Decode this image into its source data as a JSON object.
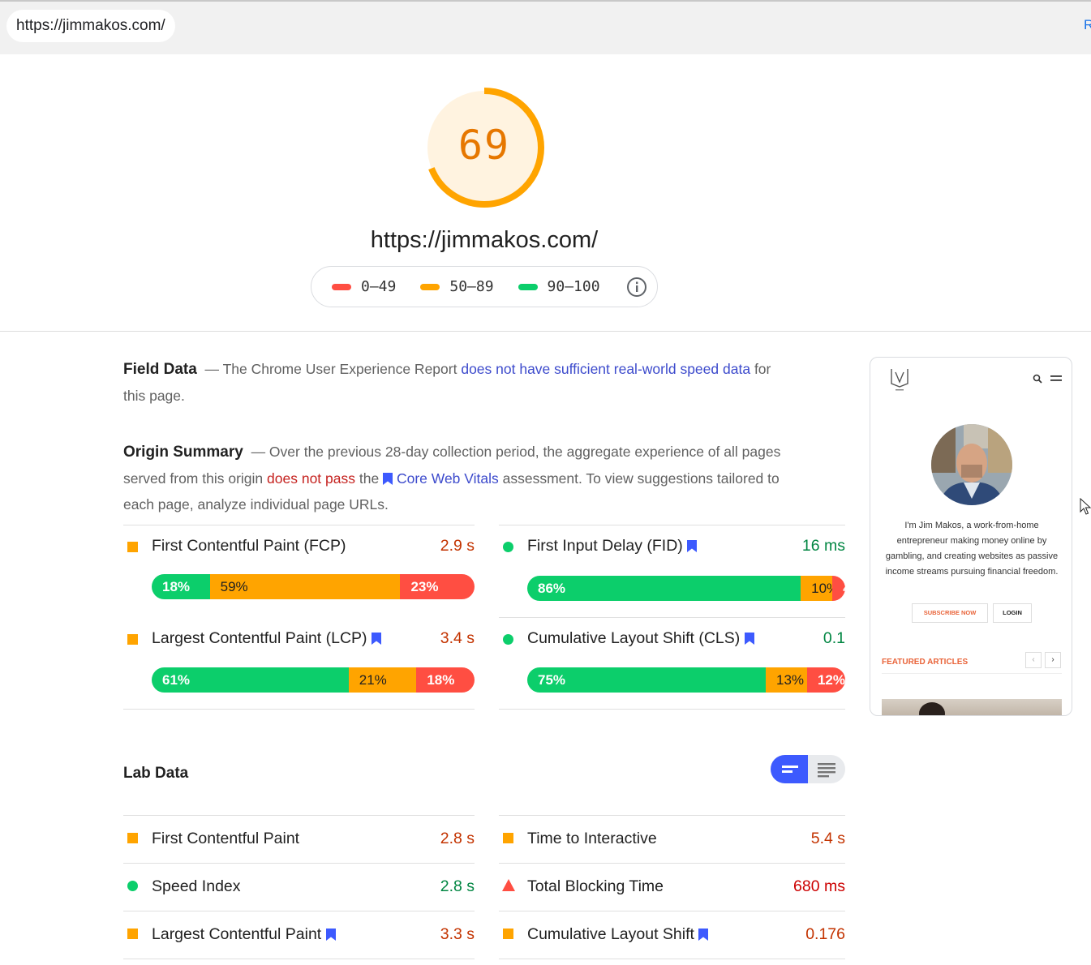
{
  "browser": {
    "url": "https://jimmakos.com/",
    "top_right": "R"
  },
  "report": {
    "score": "69",
    "url": "https://jimmakos.com/",
    "legend": [
      {
        "label": "0–49",
        "color": "#ff4e42"
      },
      {
        "label": "50–89",
        "color": "#ffa400"
      },
      {
        "label": "90–100",
        "color": "#0cce6b"
      }
    ]
  },
  "field_data": {
    "title": "Field Data",
    "dash": "— The Chrome User Experience Report",
    "link": "does not have sufficient real-world speed data",
    "tail": "for this page."
  },
  "origin_summary": {
    "title": "Origin Summary",
    "dash": "— Over the previous 28-day collection period, the aggregate experience of all pages served from this origin",
    "fail": "does not pass",
    "the": "the",
    "cwv": "Core Web Vitals",
    "tail": "assessment. To view suggestions tailored to each page, analyze individual page URLs."
  },
  "field_metrics": [
    {
      "name": "First Contentful Paint (FCP)",
      "value": "2.9 s",
      "rating": "average",
      "dist": [
        "18%",
        "59%",
        "23%"
      ],
      "fractions": [
        18,
        59,
        23
      ]
    },
    {
      "name": "First Input Delay (FID)",
      "value": "16 ms",
      "rating": "good",
      "dist": [
        "86%",
        "10%",
        "4%"
      ],
      "fractions": [
        86,
        10,
        4
      ]
    },
    {
      "name": "Largest Contentful Paint (LCP)",
      "value": "3.4 s",
      "rating": "average",
      "dist": [
        "61%",
        "21%",
        "18%"
      ],
      "fractions": [
        61,
        21,
        18
      ]
    },
    {
      "name": "Cumulative Layout Shift (CLS)",
      "value": "0.1",
      "rating": "good",
      "dist": [
        "75%",
        "13%",
        "12%"
      ],
      "fractions": [
        75,
        13,
        12
      ]
    }
  ],
  "lab_data": {
    "title": "Lab Data",
    "metrics": [
      {
        "name": "First Contentful Paint",
        "value": "2.8 s",
        "rating": "average"
      },
      {
        "name": "Time to Interactive",
        "value": "5.4 s",
        "rating": "average"
      },
      {
        "name": "Speed Index",
        "value": "2.8 s",
        "rating": "good"
      },
      {
        "name": "Total Blocking Time",
        "value": "680 ms",
        "rating": "poor"
      },
      {
        "name": "Largest Contentful Paint",
        "value": "3.3 s",
        "rating": "average"
      },
      {
        "name": "Cumulative Layout Shift",
        "value": "0.176",
        "rating": "average"
      }
    ]
  },
  "preview": {
    "bio": "I'm Jim Makos, a work-from-home entrepreneur making money online by gambling, and creating websites as passive income streams pursuing financial freedom.",
    "subscribe": "SUBSCRIBE NOW",
    "login": "LOGIN",
    "featured": "FEATURED ARTICLES",
    "prev": "‹",
    "next": "›"
  }
}
